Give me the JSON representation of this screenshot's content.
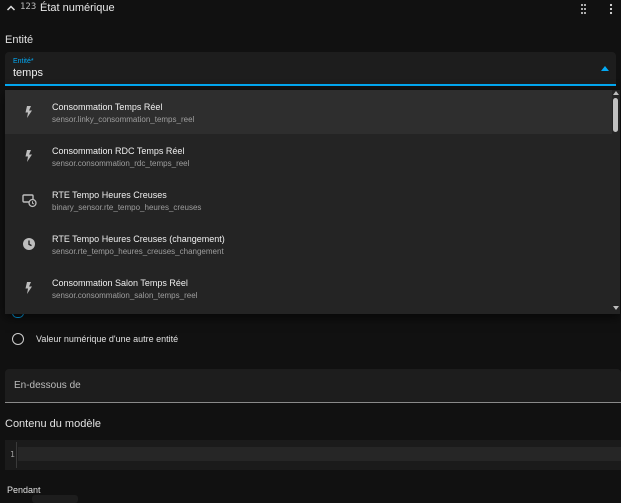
{
  "header": {
    "number_icon_text": "123",
    "title": "État numérique",
    "chevron_icon": "chevron-up-icon",
    "grid_icon": "dots-grid-icon",
    "menu_icon": "dots-vertical-icon"
  },
  "entity_section": {
    "label": "Entité"
  },
  "entity_combobox": {
    "floating_label": "Entité*",
    "value": "temps",
    "caret_icon": "caret-up-icon"
  },
  "dropdown": {
    "items": [
      {
        "title": "Consommation Temps Réel",
        "entity_id": "sensor.linky_consommation_temps_reel",
        "icon": "flash-icon"
      },
      {
        "title": "Consommation RDC Temps Réel",
        "entity_id": "sensor.consommation_rdc_temps_reel",
        "icon": "flash-icon"
      },
      {
        "title": "RTE Tempo Heures Creuses",
        "entity_id": "binary_sensor.rte_tempo_heures_creuses",
        "icon": "clock-monitor-icon"
      },
      {
        "title": "RTE Tempo Heures Creuses (changement)",
        "entity_id": "sensor.rte_tempo_heures_creuses_changement",
        "icon": "clock-icon"
      },
      {
        "title": "Consommation Salon Temps Réel",
        "entity_id": "sensor.consommation_salon_temps_reel",
        "icon": "flash-icon"
      }
    ]
  },
  "radio_option": {
    "label": "Valeur numérique d'une autre entité"
  },
  "below_field": {
    "placeholder": "En-dessous de"
  },
  "template_section": {
    "label": "Contenu du modèle"
  },
  "editor": {
    "line_number": "1"
  },
  "for_section": {
    "label": "Pendant"
  },
  "colors": {
    "accent": "#03a9f4",
    "background": "#111111",
    "surface": "#1d1d1d"
  }
}
